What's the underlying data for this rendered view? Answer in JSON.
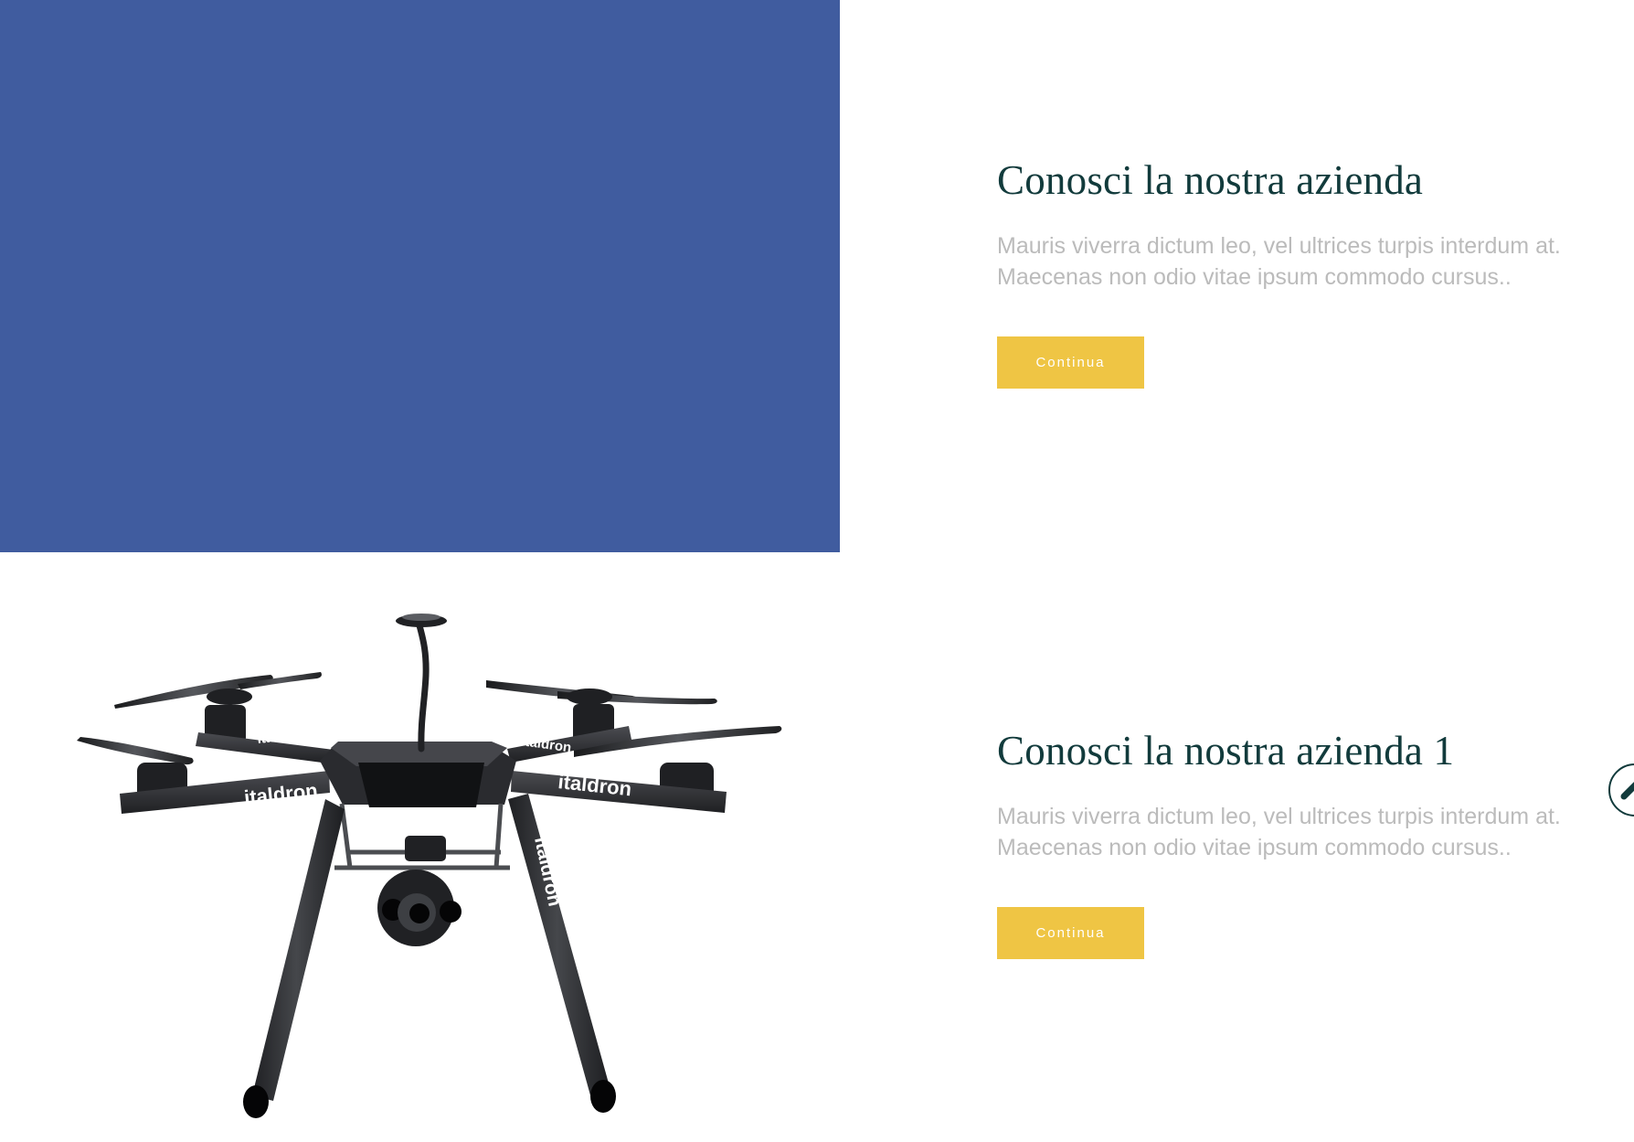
{
  "sections": [
    {
      "title": "Conosci la nostra azienda",
      "description": "Mauris viverra dictum leo, vel ultrices turpis interdum at. Maecenas non odio vitae ipsum commodo cursus..",
      "button_label": "Continua"
    },
    {
      "title": "Conosci la nostra azienda 1",
      "description": "Mauris viverra dictum leo, vel ultrices turpis interdum at. Maecenas non odio vitae ipsum commodo cursus..",
      "button_label": "Continua",
      "image_text": "italdron"
    }
  ],
  "scroll_to_top": {
    "icon": "chevron-up-icon"
  },
  "colors": {
    "panel_blue": "#405c9f",
    "title_dark_teal": "#123b3c",
    "body_gray": "#bbbbbb",
    "button_yellow": "#efc544",
    "button_text": "#ffffff",
    "drone_body": "#2f3034",
    "drone_dark": "#1f2023"
  }
}
